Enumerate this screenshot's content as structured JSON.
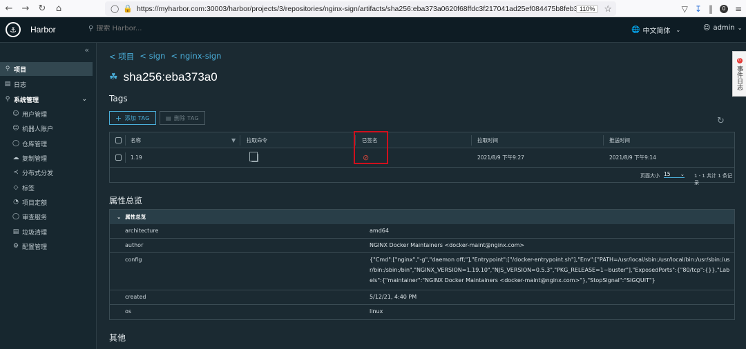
{
  "browser": {
    "url": "https://myharbor.com:30003/harbor/projects/3/repositories/nginx-sign/artifacts/sha256:eba373a0620f68ffdc3f217041ad25ef084475b8feb35b992574cd8369",
    "zoom": "110%",
    "profile_badge": "0"
  },
  "header": {
    "brand": "Harbor",
    "search_placeholder": "搜索 Harbor...",
    "language": "中文简体",
    "user": "admin"
  },
  "sidebar": {
    "items": [
      {
        "label": "项目"
      },
      {
        "label": "日志"
      },
      {
        "label": "系统管理"
      },
      {
        "label": "用户管理"
      },
      {
        "label": "机器人账户"
      },
      {
        "label": "仓库管理"
      },
      {
        "label": "复制管理"
      },
      {
        "label": "分布式分发"
      },
      {
        "label": "标签"
      },
      {
        "label": "项目定额"
      },
      {
        "label": "审查服务"
      },
      {
        "label": "垃圾清理"
      },
      {
        "label": "配置管理"
      }
    ]
  },
  "breadcrumb": {
    "items": [
      "< 项目",
      "< sign",
      "< nginx-sign"
    ]
  },
  "artifact": {
    "title": "sha256:eba373a0"
  },
  "tags_section": {
    "heading": "Tags",
    "add_button": "添加 TAG",
    "delete_button": "删除 TAG",
    "columns": [
      "名称",
      "拉取命令",
      "已签名",
      "拉取时间",
      "推送时间"
    ],
    "rows": [
      {
        "name": "1.19",
        "pull_time": "2021/8/9 下午9:27",
        "push_time": "2021/8/9 下午9:14"
      }
    ],
    "page_size_label": "页面大小",
    "page_size": "15",
    "page_info": "1 - 1 共计 1 条记录"
  },
  "properties_section": {
    "heading": "属性总览",
    "panel_title": "属性总览",
    "rows": [
      {
        "key": "architecture",
        "value": "amd64"
      },
      {
        "key": "author",
        "value": "NGINX Docker Maintainers <docker-maint@nginx.com>"
      },
      {
        "key": "config",
        "value": "{\"Cmd\":[\"nginx\",\"-g\",\"daemon off;\"],\"Entrypoint\":[\"/docker-entrypoint.sh\"],\"Env\":[\"PATH=/usr/local/sbin:/usr/local/bin:/usr/sbin:/usr/bin:/sbin:/bin\",\"NGINX_VERSION=1.19.10\",\"NJS_VERSION=0.5.3\",\"PKG_RELEASE=1~buster\"],\"ExposedPorts\":{\"80/tcp\":{}},\"Labels\":{\"maintainer\":\"NGINX Docker Maintainers <docker-maint@nginx.com>\"},\"StopSignal\":\"SIGQUIT\"}"
      },
      {
        "key": "created",
        "value": "5/12/21, 4:40 PM"
      },
      {
        "key": "os",
        "value": "linux"
      }
    ]
  },
  "other_section": {
    "heading": "其他"
  },
  "side_tab": {
    "label": "事件日志",
    "count": "0"
  },
  "colors": {
    "accent": "#4aaed9",
    "highlight": "#d0101d",
    "signed_status": "#d0453b"
  }
}
